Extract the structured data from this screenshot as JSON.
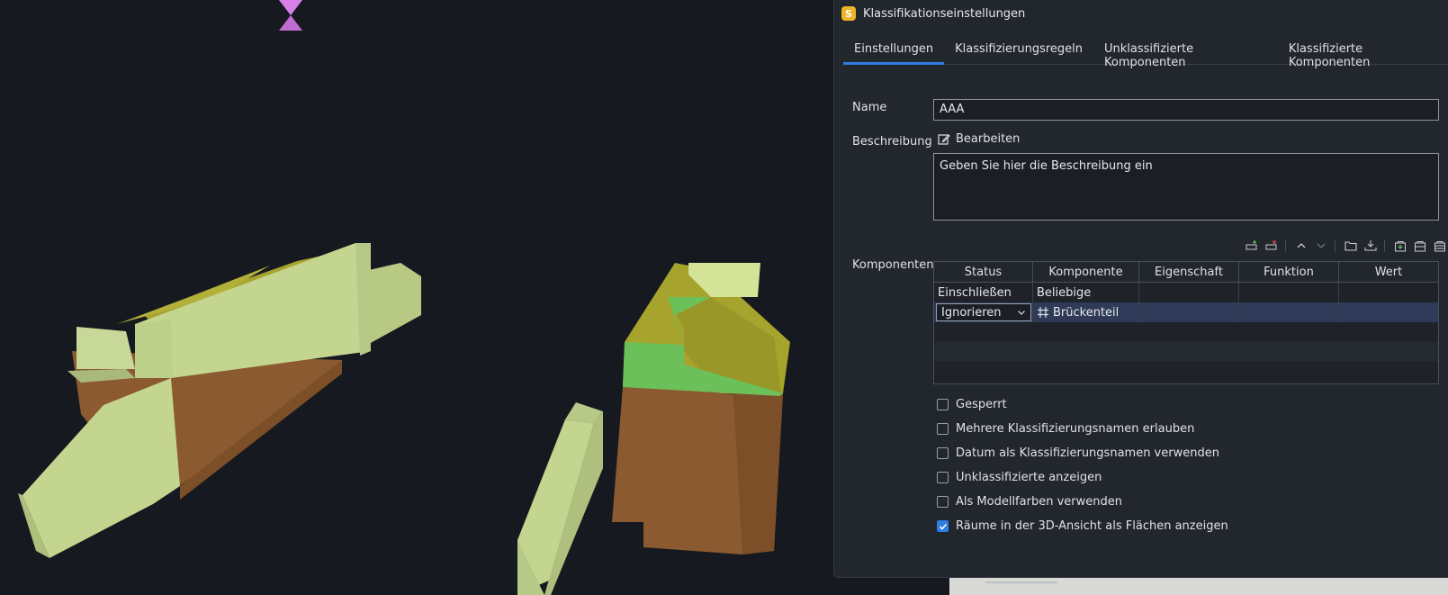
{
  "window": {
    "title": "Klassifikationseinstellungen",
    "app_icon": "S"
  },
  "tabs": [
    {
      "label": "Einstellungen",
      "active": true
    },
    {
      "label": "Klassifizierungsregeln",
      "active": false
    },
    {
      "label": "Unklassifizierte Komponenten",
      "active": false
    },
    {
      "label": "Klassifizierte Komponenten",
      "active": false
    }
  ],
  "form": {
    "name_label": "Name",
    "name_value": "AAA",
    "description_label": "Beschreibung",
    "edit_label": "Bearbeiten",
    "description_placeholder": "Geben Sie hier die Beschreibung ein",
    "components_label": "Komponenten"
  },
  "toolbar_icons": [
    "add-row-icon",
    "remove-row-icon",
    "move-up-icon",
    "move-down-icon",
    "open-folder-icon",
    "import-icon",
    "add-package-icon",
    "package-icon",
    "package-alt-icon"
  ],
  "table": {
    "columns": [
      "Status",
      "Komponente",
      "Eigenschaft",
      "Funktion",
      "Wert"
    ],
    "rows": [
      {
        "status": "Einschließen",
        "component": "Beliebige",
        "property": "",
        "function": "",
        "value": ""
      },
      {
        "status": "Ignorieren",
        "component": "Brückenteil",
        "property": "",
        "function": "",
        "value": "",
        "selected": true
      }
    ]
  },
  "options": [
    {
      "label": "Gesperrt",
      "checked": false
    },
    {
      "label": "Mehrere Klassifizierungsnamen erlauben",
      "checked": false
    },
    {
      "label": "Datum als Klassifizierungsnamen verwenden",
      "checked": false
    },
    {
      "label": "Unklassifizierte anzeigen",
      "checked": false
    },
    {
      "label": "Als Modellfarben verwenden",
      "checked": false
    },
    {
      "label": "Räume in der 3D-Ansicht als Flächen anzeigen",
      "checked": true
    }
  ],
  "colors": {
    "accent": "#2f7de1",
    "viewport_bg": "#16191f",
    "panel_bg": "#22262d",
    "model_light_green": "#c3d58f",
    "model_olive": "#a6a42c",
    "model_green": "#6cc05a",
    "model_brown": "#8b5a30",
    "marker_pink": "#d880e8"
  }
}
